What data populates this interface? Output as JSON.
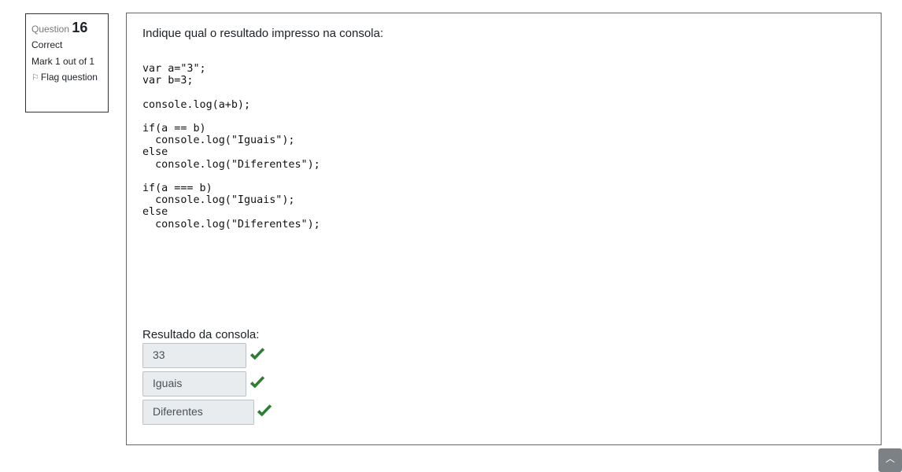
{
  "question_info": {
    "label": "Question",
    "number": "16",
    "state": "Correct",
    "grade": "Mark 1 out of 1",
    "flag_label": "Flag question"
  },
  "question": {
    "text": "Indique qual o resultado impresso na consola:",
    "code": "var a=\"3\";\nvar b=3;\n\nconsole.log(a+b);\n\nif(a == b)\n  console.log(\"Iguais\");\nelse\n  console.log(\"Diferentes\");\n\nif(a === b)\n  console.log(\"Iguais\");\nelse\n  console.log(\"Diferentes\");",
    "result_label": "Resultado da consola:"
  },
  "answers": [
    {
      "value": "33",
      "correct": true
    },
    {
      "value": "Iguais",
      "correct": true
    },
    {
      "value": "Diferentes",
      "correct": true
    }
  ],
  "colors": {
    "check": "#2e7d32",
    "answer_bg": "#e9ecef"
  },
  "icons": {
    "flag": "flag-icon",
    "check": "check-icon",
    "scroll_top": "chevron-up-icon"
  }
}
